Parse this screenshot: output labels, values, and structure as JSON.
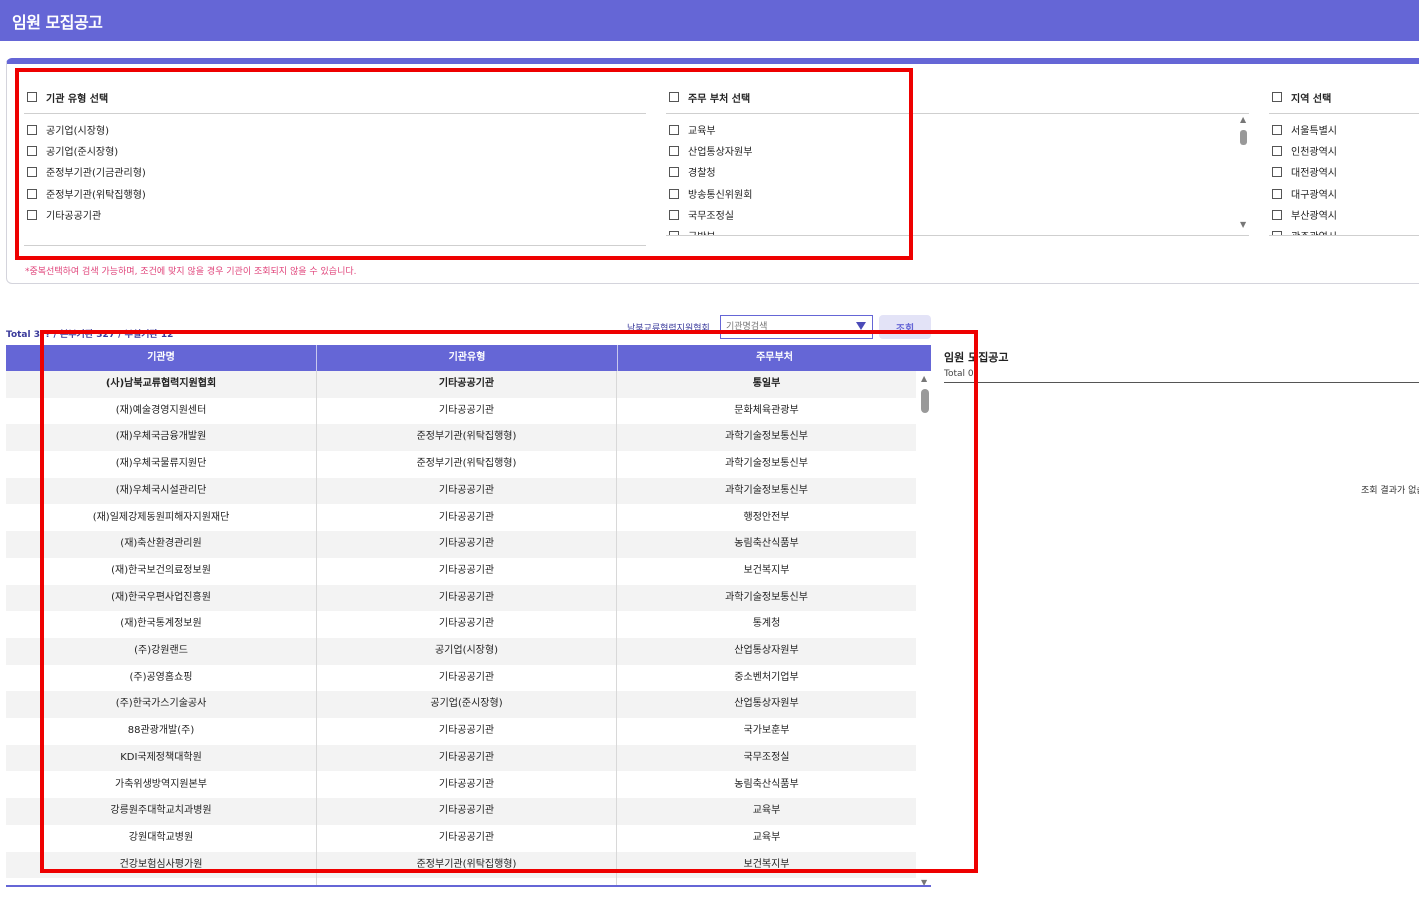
{
  "header": {
    "title": "임원 모집공고"
  },
  "filters": {
    "type_group": {
      "title": "기관 유형 선택",
      "items": [
        "공기업(시장형)",
        "공기업(준시장형)",
        "준정부기관(기금관리형)",
        "준정부기관(위탁집행형)",
        "기타공공기관"
      ]
    },
    "ministry_group": {
      "title": "주무 부처 선택",
      "items": [
        "교육부",
        "산업통상자원부",
        "경찰청",
        "방송통신위원회",
        "국무조정실",
        "국방부"
      ]
    },
    "region_group": {
      "title": "지역 선택",
      "items": [
        "서울특별시",
        "인천광역시",
        "대전광역시",
        "대구광역시",
        "부산광역시",
        "광주광역시"
      ]
    },
    "note": "*중복선택하여 검색 가능하며, 조건에 맞지 않을 경우 기관이 조회되지 않을 수 있습니다."
  },
  "search": {
    "totals": "Total 3?? / 본부기관 327 / 부설기관 12",
    "selected_institution": "남북교류협력지원협회",
    "input_placeholder": "기관명검색",
    "button_label": "조회"
  },
  "table": {
    "headers": [
      "기관명",
      "기관유형",
      "주무부처"
    ],
    "rows": [
      [
        "(사)남북교류협력지원협회",
        "기타공공기관",
        "통일부"
      ],
      [
        "(재)예술경영지원센터",
        "기타공공기관",
        "문화체육관광부"
      ],
      [
        "(재)우체국금융개발원",
        "준정부기관(위탁집행형)",
        "과학기술정보통신부"
      ],
      [
        "(재)우체국물류지원단",
        "준정부기관(위탁집행형)",
        "과학기술정보통신부"
      ],
      [
        "(재)우체국시설관리단",
        "기타공공기관",
        "과학기술정보통신부"
      ],
      [
        "(재)일제강제동원피해자지원재단",
        "기타공공기관",
        "행정안전부"
      ],
      [
        "(재)축산환경관리원",
        "기타공공기관",
        "농림축산식품부"
      ],
      [
        "(재)한국보건의료정보원",
        "기타공공기관",
        "보건복지부"
      ],
      [
        "(재)한국우편사업진흥원",
        "기타공공기관",
        "과학기술정보통신부"
      ],
      [
        "(재)한국통계정보원",
        "기타공공기관",
        "통계청"
      ],
      [
        "(주)강원랜드",
        "공기업(시장형)",
        "산업통상자원부"
      ],
      [
        "(주)공영홈쇼핑",
        "기타공공기관",
        "중소벤처기업부"
      ],
      [
        "(주)한국가스기술공사",
        "공기업(준시장형)",
        "산업통상자원부"
      ],
      [
        "88관광개발(주)",
        "기타공공기관",
        "국가보훈부"
      ],
      [
        "KDI국제정책대학원",
        "기타공공기관",
        "국무조정실"
      ],
      [
        "가축위생방역지원본부",
        "기타공공기관",
        "농림축산식품부"
      ],
      [
        "강릉원주대학교치과병원",
        "기타공공기관",
        "교육부"
      ],
      [
        "강원대학교병원",
        "기타공공기관",
        "교육부"
      ],
      [
        "건강보험심사평가원",
        "준정부기관(위탁집행형)",
        "보건복지부"
      ]
    ]
  },
  "right_panel": {
    "title": "임원 모집공고",
    "total": "Total 0",
    "no_result": "조회 결과가 없습니다."
  },
  "colors": {
    "brand": "#6566d6",
    "note": "#e0457b",
    "highlight": "#ee0000"
  }
}
